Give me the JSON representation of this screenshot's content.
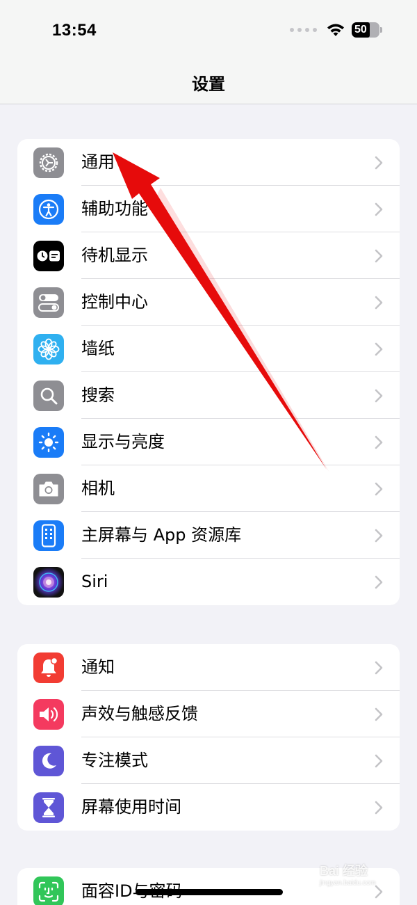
{
  "status_bar": {
    "time": "13:54",
    "battery_level": "50"
  },
  "nav": {
    "title": "设置"
  },
  "groups": [
    {
      "items": [
        {
          "label": "通用",
          "icon": "gear-icon",
          "icon_color": "#8e8e93"
        },
        {
          "label": "辅助功能",
          "icon": "accessibility-icon",
          "icon_color": "#1a7cf7"
        },
        {
          "label": "待机显示",
          "icon": "standby-icon",
          "icon_color": "#000000"
        },
        {
          "label": "控制中心",
          "icon": "toggles-icon",
          "icon_color": "#8e8e93"
        },
        {
          "label": "墙纸",
          "icon": "flower-icon",
          "icon_color": "#2fb0f0"
        },
        {
          "label": "搜索",
          "icon": "magnifier-icon",
          "icon_color": "#8e8e93"
        },
        {
          "label": "显示与亮度",
          "icon": "sun-icon",
          "icon_color": "#1a7cf7"
        },
        {
          "label": "相机",
          "icon": "camera-icon",
          "icon_color": "#8e8e93"
        },
        {
          "label": "主屏幕与 App 资源库",
          "icon": "homescreen-icon",
          "icon_color": "#1a7cf7"
        },
        {
          "label": "Siri",
          "icon": "siri-icon",
          "icon_color": "#222222"
        }
      ]
    },
    {
      "items": [
        {
          "label": "通知",
          "icon": "bell-icon",
          "icon_color": "#f23c33"
        },
        {
          "label": "声效与触感反馈",
          "icon": "speaker-icon",
          "icon_color": "#f43a5f"
        },
        {
          "label": "专注模式",
          "icon": "moon-icon",
          "icon_color": "#5f56d6"
        },
        {
          "label": "屏幕使用时间",
          "icon": "hourglass-icon",
          "icon_color": "#5f56d6"
        }
      ]
    },
    {
      "items": [
        {
          "label": "面容ID与密码",
          "icon": "faceid-icon",
          "icon_color": "#31c659"
        }
      ]
    }
  ],
  "watermark": {
    "text": "Bai 经验",
    "sub": "jingyan.baidu.com"
  },
  "annotation": {
    "type": "red-arrow",
    "target": "通用"
  }
}
